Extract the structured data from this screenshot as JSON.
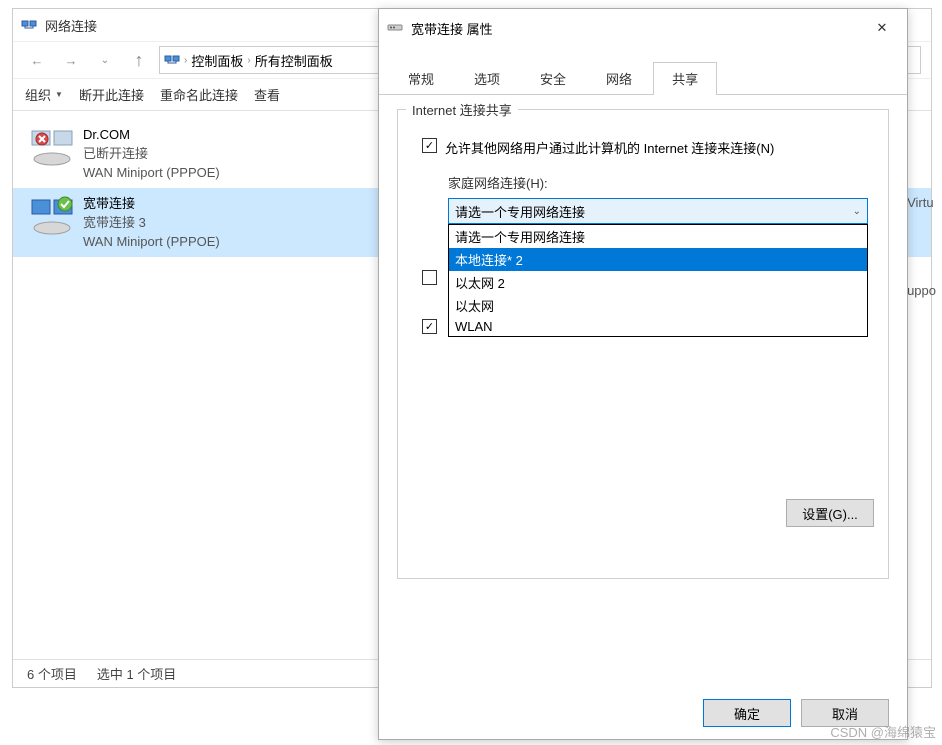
{
  "explorer": {
    "title": "网络连接",
    "nav": {
      "breadcrumb": [
        "控制面板",
        "所有控制面板"
      ]
    },
    "toolbar": {
      "organize": "组织",
      "disconnect": "断开此连接",
      "rename": "重命名此连接",
      "view": "查看"
    },
    "connections": [
      {
        "name": "Dr.COM",
        "status": "已断开连接",
        "driver": "WAN Miniport (PPPOE)",
        "selected": false,
        "badge": "none"
      },
      {
        "name": "宽带连接",
        "status": "宽带连接 3",
        "driver": "WAN Miniport (PPPOE)",
        "selected": true,
        "badge": "check"
      }
    ],
    "status": {
      "count": "6 个项目",
      "selected": "选中 1 个项目"
    },
    "right_hints": [
      "Virtu",
      "uppo"
    ]
  },
  "dialog": {
    "title": "宽带连接 属性",
    "tabs": [
      "常规",
      "选项",
      "安全",
      "网络",
      "共享"
    ],
    "active_tab": 4,
    "group_title": "Internet 连接共享",
    "chk_allow_label": "允许其他网络用户通过此计算机的 Internet 连接来连接(N)",
    "home_net_label": "家庭网络连接(H):",
    "select_placeholder": "请选一个专用网络连接",
    "dropdown_items": [
      "请选一个专用网络连接",
      "本地连接* 2",
      "以太网 2",
      "以太网",
      "WLAN"
    ],
    "dropdown_highlight_index": 1,
    "chk_other1_label": "",
    "chk_other2_label": "",
    "settings_btn": "设置(G)...",
    "ok_btn": "确定",
    "cancel_btn": "取消"
  },
  "watermark": "CSDN @海绵猿宝"
}
